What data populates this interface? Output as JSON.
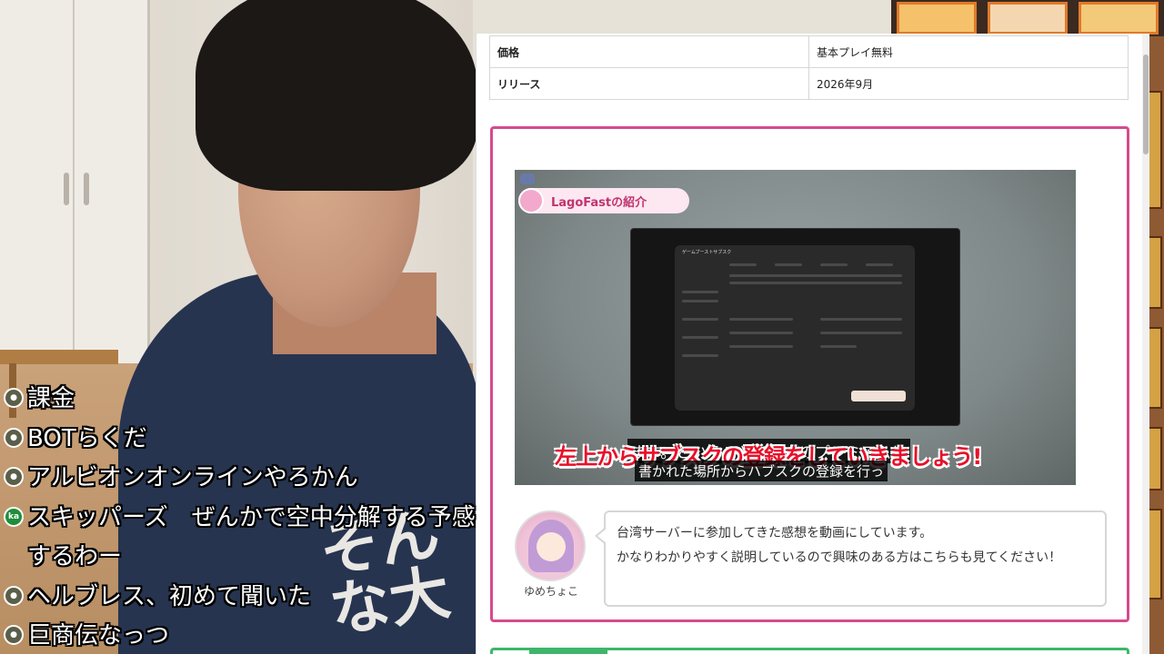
{
  "comments": [
    {
      "text": "課金",
      "icon": "user-icon"
    },
    {
      "text": "BOTらくだ",
      "icon": "user-icon"
    },
    {
      "text": "アルビオンオンラインやろかん",
      "icon": "user-icon"
    },
    {
      "text": "スキッパーズ　ぜんかで空中分解する予感するわー",
      "icon": "ka",
      "multi": true
    },
    {
      "text": "ヘルブレス、初めて聞いた",
      "icon": "user-icon"
    },
    {
      "text": "巨商伝なっつ",
      "icon": "user-icon"
    }
  ],
  "shirt_text": "そんな大",
  "info_table": [
    {
      "key": "価格",
      "value": "基本プレイ無料"
    },
    {
      "key": "リリース",
      "value": "2026年9月"
    }
  ],
  "video": {
    "badge": "LagoFastの紹介",
    "modal_title": "ゲームブーストサブスク",
    "subtitle_red": "左上からサブスクの登録をしていきましょう!",
    "subtitle_white_1": "ます。ということで左上のプレミアムと",
    "subtitle_white_2": "書かれた場所からハブスクの登録を行っ"
  },
  "author": {
    "name": "ゆめちょこ"
  },
  "bubble": {
    "line1": "台湾サーバーに参加してきた感想を動画にしています。",
    "line2": "かなりわかりやすく説明しているので興味のある方はこちらも見てください！"
  },
  "colors": {
    "box_border": "#d64a8e",
    "box2_border": "#3db66b",
    "subtitle_red": "#e8102a"
  }
}
